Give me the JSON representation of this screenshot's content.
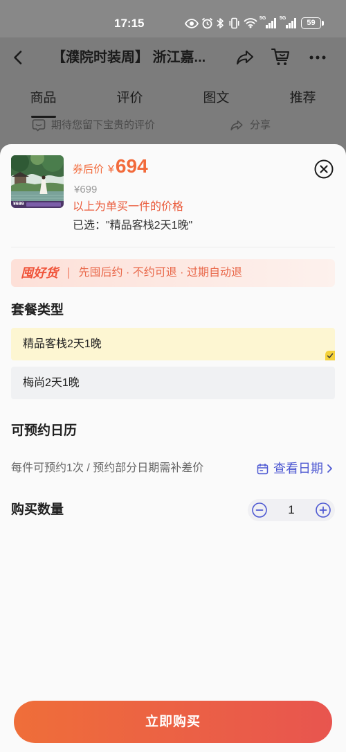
{
  "status_bar": {
    "time": "17:15",
    "network_1": "5G",
    "network_2": "5G",
    "battery": "59"
  },
  "header": {
    "title": "【濮院时装周】 浙江嘉..."
  },
  "tabs": [
    {
      "label": "商品",
      "active": true
    },
    {
      "label": "评价",
      "active": false
    },
    {
      "label": "图文",
      "active": false
    },
    {
      "label": "推荐",
      "active": false
    }
  ],
  "review_bar": {
    "prompt": "期待您留下宝贵的评价",
    "share": "分享"
  },
  "sku": {
    "image_price": "¥699",
    "price_label": "券后价",
    "currency": "¥",
    "price": "694",
    "original_price": "¥699",
    "price_note": "以上为单买一件的价格",
    "selected": "已选：\"精品客栈2天1晚\""
  },
  "banner": {
    "logo": "囤好货",
    "text": "先囤后约 · 不约可退 · 过期自动退"
  },
  "package": {
    "title": "套餐类型",
    "options": [
      {
        "label": "精品客栈2天1晚",
        "selected": true
      },
      {
        "label": "梅尚2天1晚",
        "selected": false
      }
    ]
  },
  "calendar": {
    "title": "可预约日历",
    "note": "每件可预约1次 / 预约部分日期需补差价",
    "link": "查看日期"
  },
  "quantity": {
    "title": "购买数量",
    "value": "1"
  },
  "buy_button": {
    "label": "立即购买"
  },
  "icons": {
    "back": "back-arrow-icon",
    "share": "share-icon",
    "cart": "cart-icon",
    "more": "more-icon",
    "close": "close-icon",
    "calendar": "calendar-icon",
    "minus": "minus-circle-icon",
    "plus": "plus-circle-icon"
  },
  "colors": {
    "accent": "#f26a3b",
    "accent_note": "#ea5a3a",
    "link": "#4d58d2",
    "selected_option_bg": "#fdf6d2",
    "button_start": "#ef6e39",
    "button_end": "#e8554f"
  }
}
